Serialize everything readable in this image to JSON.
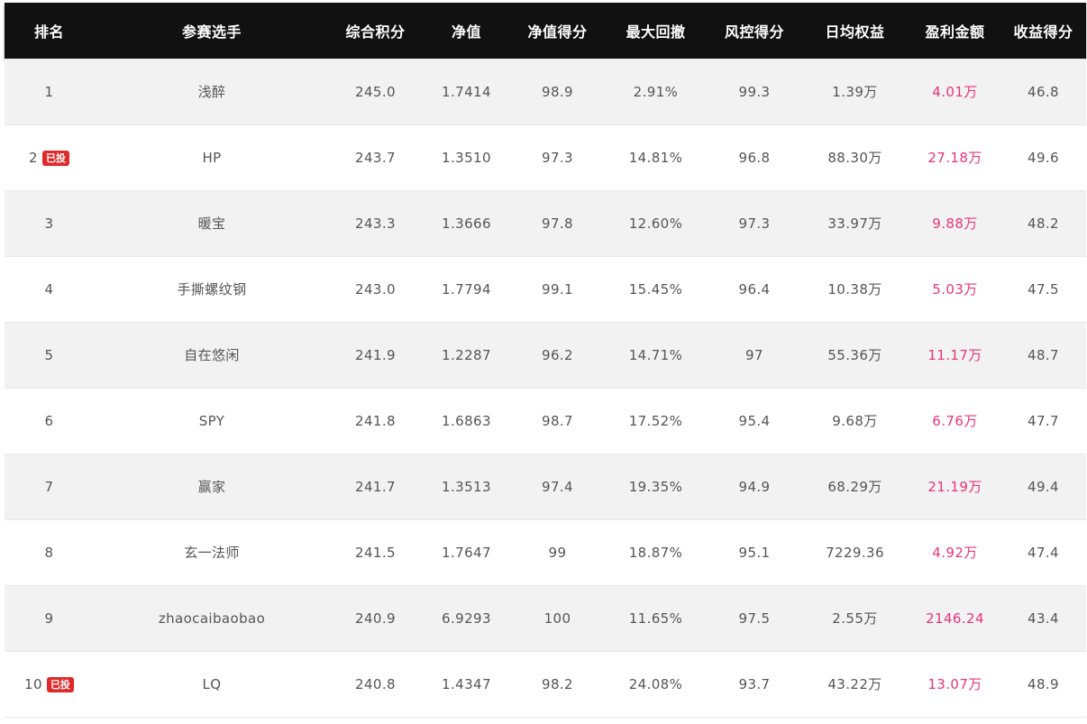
{
  "columns": [
    "排名",
    "参赛选手",
    "综合积分",
    "净值",
    "净值得分",
    "最大回撤",
    "风控得分",
    "日均权益",
    "盈利金额",
    "收益得分"
  ],
  "colors": {
    "header_bg": "#111111",
    "row_alt_bg": "#f2f2f2",
    "profit_text": "#e8357a",
    "badge_bg": "#e02929"
  },
  "rows": [
    {
      "rank": "1",
      "badge": "",
      "player": "浅醉",
      "score": "245.0",
      "nav": "1.7414",
      "nav_score": "98.9",
      "max_drawdown": "2.91%",
      "risk_score": "99.3",
      "avg_equity": "1.39万",
      "profit": "4.01万",
      "return_score": "46.8"
    },
    {
      "rank": "2",
      "badge": "已投",
      "player": "HP",
      "score": "243.7",
      "nav": "1.3510",
      "nav_score": "97.3",
      "max_drawdown": "14.81%",
      "risk_score": "96.8",
      "avg_equity": "88.30万",
      "profit": "27.18万",
      "return_score": "49.6"
    },
    {
      "rank": "3",
      "badge": "",
      "player": "暖宝",
      "score": "243.3",
      "nav": "1.3666",
      "nav_score": "97.8",
      "max_drawdown": "12.60%",
      "risk_score": "97.3",
      "avg_equity": "33.97万",
      "profit": "9.88万",
      "return_score": "48.2"
    },
    {
      "rank": "4",
      "badge": "",
      "player": "手撕螺纹钢",
      "score": "243.0",
      "nav": "1.7794",
      "nav_score": "99.1",
      "max_drawdown": "15.45%",
      "risk_score": "96.4",
      "avg_equity": "10.38万",
      "profit": "5.03万",
      "return_score": "47.5"
    },
    {
      "rank": "5",
      "badge": "",
      "player": "自在悠闲",
      "score": "241.9",
      "nav": "1.2287",
      "nav_score": "96.2",
      "max_drawdown": "14.71%",
      "risk_score": "97",
      "avg_equity": "55.36万",
      "profit": "11.17万",
      "return_score": "48.7"
    },
    {
      "rank": "6",
      "badge": "",
      "player": "SPY",
      "score": "241.8",
      "nav": "1.6863",
      "nav_score": "98.7",
      "max_drawdown": "17.52%",
      "risk_score": "95.4",
      "avg_equity": "9.68万",
      "profit": "6.76万",
      "return_score": "47.7"
    },
    {
      "rank": "7",
      "badge": "",
      "player": "赢家",
      "score": "241.7",
      "nav": "1.3513",
      "nav_score": "97.4",
      "max_drawdown": "19.35%",
      "risk_score": "94.9",
      "avg_equity": "68.29万",
      "profit": "21.19万",
      "return_score": "49.4"
    },
    {
      "rank": "8",
      "badge": "",
      "player": "玄一法师",
      "score": "241.5",
      "nav": "1.7647",
      "nav_score": "99",
      "max_drawdown": "18.87%",
      "risk_score": "95.1",
      "avg_equity": "7229.36",
      "profit": "4.92万",
      "return_score": "47.4"
    },
    {
      "rank": "9",
      "badge": "",
      "player": "zhaocaibaobao",
      "score": "240.9",
      "nav": "6.9293",
      "nav_score": "100",
      "max_drawdown": "11.65%",
      "risk_score": "97.5",
      "avg_equity": "2.55万",
      "profit": "2146.24",
      "return_score": "43.4"
    },
    {
      "rank": "10",
      "badge": "已投",
      "player": "LQ",
      "score": "240.8",
      "nav": "1.4347",
      "nav_score": "98.2",
      "max_drawdown": "24.08%",
      "risk_score": "93.7",
      "avg_equity": "43.22万",
      "profit": "13.07万",
      "return_score": "48.9"
    }
  ]
}
